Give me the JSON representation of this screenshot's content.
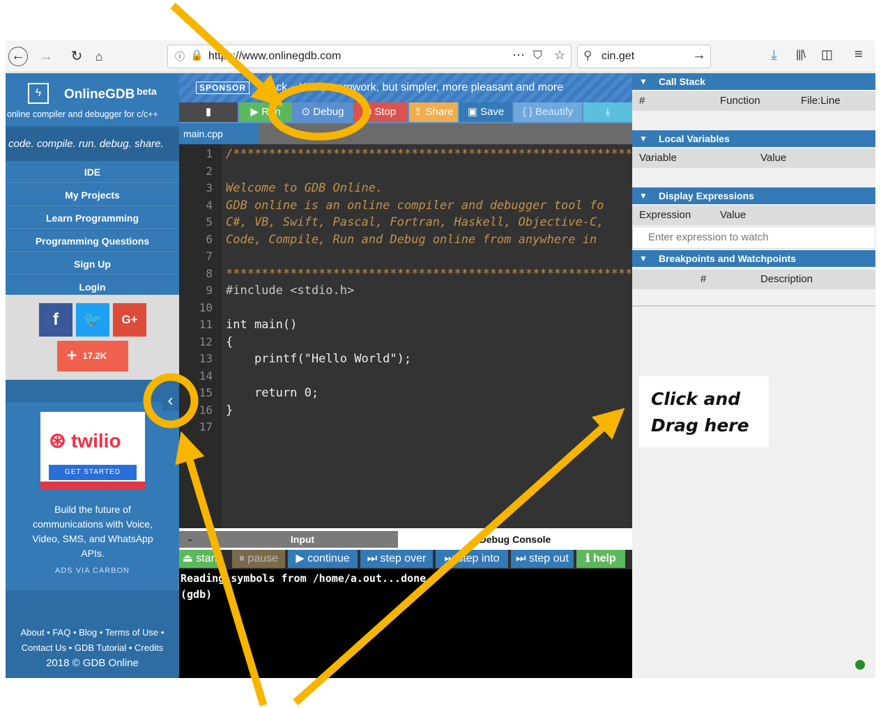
{
  "browser": {
    "url": "https://www.onlinegdb.com",
    "url_display": "https://www.onlinegdb.com",
    "search_value": "cin.get",
    "icons": [
      "back-icon",
      "forward-icon",
      "reload-icon",
      "home-icon",
      "info-icon",
      "lock-icon",
      "more-icon",
      "pocket-icon",
      "bookmark-star-icon",
      "search-icon",
      "go-arrow-icon",
      "download-icon",
      "library-icon",
      "sidebar-icon",
      "menu-icon"
    ]
  },
  "sidebar": {
    "brand": "OnlineGDB",
    "beta": "beta",
    "subtitle": "online compiler and debugger for c/c++",
    "tagline": "code. compile. run. debug. share.",
    "menu": [
      "IDE",
      "My Projects",
      "Learn Programming",
      "Programming Questions",
      "Sign Up",
      "Login"
    ],
    "social_count": "17.2K",
    "ad": {
      "logo": "twilio",
      "cta": "GET STARTED",
      "text": "Build the future of communications with Voice, Video, SMS, and WhatsApp APIs.",
      "via": "ADS VIA CARBON"
    },
    "footer_line1": "About • FAQ • Blog • Terms of Use •",
    "footer_line2": "Contact Us • GDB Tutorial • Credits",
    "footer_line3": "2018 © GDB Online"
  },
  "sponsor": {
    "label": "SPONSOR",
    "text": "Slack – Wait, teamwork, but simpler, more pleasant and more"
  },
  "toolbar": {
    "run": "Run",
    "debug": "Debug",
    "stop": "Stop",
    "share": "Share",
    "save": "Save",
    "beautify": "{ } Beautify"
  },
  "editor": {
    "tab": "main.cpp",
    "lines": [
      {
        "n": "1",
        "text": "/*********************************************************"
      },
      {
        "n": "2",
        "text": ""
      },
      {
        "n": "3",
        "text": "Welcome to GDB Online."
      },
      {
        "n": "4",
        "text": "GDB online is an online compiler and debugger tool fo"
      },
      {
        "n": "5",
        "text": "C#, VB, Swift, Pascal, Fortran, Haskell, Objective-C,"
      },
      {
        "n": "6",
        "text": "Code, Compile, Run and Debug online from anywhere in"
      },
      {
        "n": "7",
        "text": ""
      },
      {
        "n": "8",
        "text": "*********************************************************"
      },
      {
        "n": "9",
        "text": "#include <stdio.h>"
      },
      {
        "n": "10",
        "text": ""
      },
      {
        "n": "11",
        "text": "int main()"
      },
      {
        "n": "12",
        "text": "{"
      },
      {
        "n": "13",
        "text": "    printf(\"Hello World\");"
      },
      {
        "n": "14",
        "text": ""
      },
      {
        "n": "15",
        "text": "    return 0;"
      },
      {
        "n": "16",
        "text": "}"
      },
      {
        "n": "17",
        "text": ""
      }
    ]
  },
  "io": {
    "input_tab": "Input",
    "debug_tab": "Debug Console",
    "buttons": [
      "start",
      "pause",
      "continue",
      "step over",
      "step into",
      "step out",
      "help"
    ],
    "console_lines": [
      "Reading symbols from /home/a.out...done.",
      "(gdb)"
    ]
  },
  "debug_panel": {
    "call_stack": {
      "title": "Call Stack",
      "cols": [
        "#",
        "Function",
        "File:Line"
      ]
    },
    "local_vars": {
      "title": "Local Variables",
      "cols": [
        "Variable",
        "Value"
      ]
    },
    "display_expr": {
      "title": "Display Expressions",
      "cols": [
        "Expression",
        "Value"
      ],
      "placeholder": "Enter expression to watch"
    },
    "breakpoints": {
      "title": "Breakpoints and Watchpoints",
      "cols": [
        "#",
        "Description"
      ]
    }
  },
  "annotation": {
    "line1": "Click and",
    "line2": "Drag here"
  },
  "colors": {
    "annotation": "#f7b500",
    "brand": "#337ab7",
    "run": "#5cb85c",
    "stop": "#d9534f",
    "share": "#f0ad4e"
  }
}
